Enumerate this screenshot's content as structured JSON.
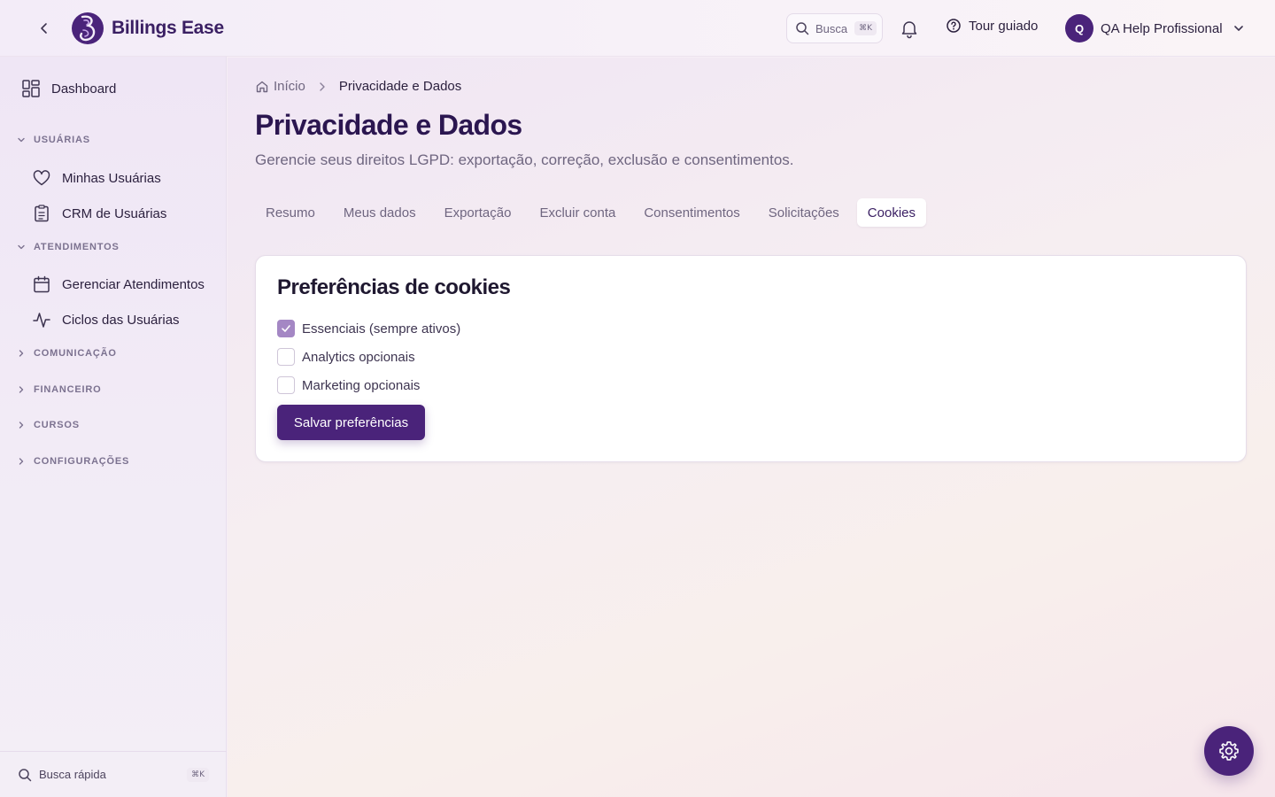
{
  "topbar": {
    "brand": "Billings Ease",
    "search_label": "Busca",
    "search_shortcut": "⌘K",
    "tour_label": "Tour guiado",
    "user_initial": "Q",
    "user_name": "QA Help Profissional"
  },
  "sidebar": {
    "dashboard": "Dashboard",
    "sections": [
      {
        "label": "USUÁRIAS",
        "expanded": true,
        "items": [
          "Minhas Usuárias",
          "CRM de Usuárias"
        ]
      },
      {
        "label": "ATENDIMENTOS",
        "expanded": true,
        "items": [
          "Gerenciar Atendimentos",
          "Ciclos das Usuárias"
        ]
      },
      {
        "label": "COMUNICAÇÃO",
        "expanded": false
      },
      {
        "label": "FINANCEIRO",
        "expanded": false
      },
      {
        "label": "CURSOS",
        "expanded": false
      },
      {
        "label": "CONFIGURAÇÕES",
        "expanded": false
      }
    ],
    "quick_search": "Busca rápida",
    "quick_shortcut": "⌘K"
  },
  "breadcrumb": {
    "home": "Início",
    "current": "Privacidade e Dados"
  },
  "page": {
    "title": "Privacidade e Dados",
    "subtitle": "Gerencie seus direitos LGPD: exportação, correção, exclusão e consentimentos."
  },
  "tabs": [
    "Resumo",
    "Meus dados",
    "Exportação",
    "Excluir conta",
    "Consentimentos",
    "Solicitações",
    "Cookies"
  ],
  "active_tab": "Cookies",
  "cookies": {
    "title": "Preferências de cookies",
    "options": [
      {
        "label": "Essenciais (sempre ativos)",
        "checked": true
      },
      {
        "label": "Analytics opcionais",
        "checked": false
      },
      {
        "label": "Marketing opcionais",
        "checked": false
      }
    ],
    "save_label": "Salvar preferências"
  },
  "colors": {
    "brand": "#4a237a",
    "checkbox_checked": "#a487c4"
  }
}
